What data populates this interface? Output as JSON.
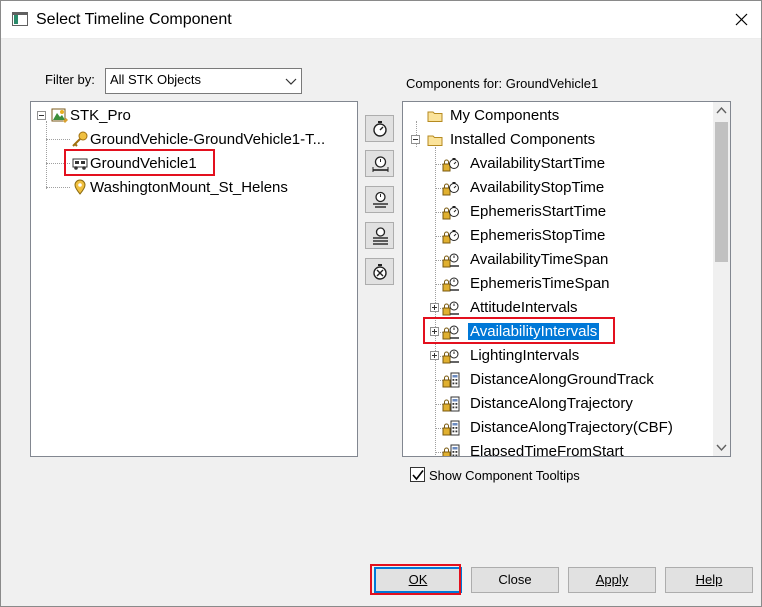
{
  "window": {
    "title": "Select Timeline Component"
  },
  "filter": {
    "label": "Filter by:",
    "selected": "All STK Objects"
  },
  "objects_tree": {
    "items": [
      {
        "label": "STK_Pro",
        "icon": "scenario-icon"
      },
      {
        "label": "GroundVehicle-GroundVehicle1-T...",
        "icon": "access-key-icon"
      },
      {
        "label": "GroundVehicle1",
        "icon": "ground-vehicle-icon",
        "highlighted": true
      },
      {
        "label": "WashingtonMount_St_Helens",
        "icon": "place-pin-icon"
      }
    ]
  },
  "components": {
    "label": "Components for: GroundVehicle1",
    "items": [
      {
        "label": "My Components",
        "icon": "folder-icon"
      },
      {
        "label": "Installed Components",
        "icon": "folder-icon"
      },
      {
        "label": "AvailabilityStartTime",
        "icon": "time-instant-icon"
      },
      {
        "label": "AvailabilityStopTime",
        "icon": "time-instant-icon"
      },
      {
        "label": "EphemerisStartTime",
        "icon": "time-instant-icon"
      },
      {
        "label": "EphemerisStopTime",
        "icon": "time-instant-icon"
      },
      {
        "label": "AvailabilityTimeSpan",
        "icon": "time-span-icon"
      },
      {
        "label": "EphemerisTimeSpan",
        "icon": "time-span-icon"
      },
      {
        "label": "AttitudeIntervals",
        "icon": "time-span-icon"
      },
      {
        "label": "AvailabilityIntervals",
        "icon": "time-span-icon",
        "selected": true
      },
      {
        "label": "LightingIntervals",
        "icon": "time-span-icon"
      },
      {
        "label": "DistanceAlongGroundTrack",
        "icon": "calc-icon"
      },
      {
        "label": "DistanceAlongTrajectory",
        "icon": "calc-icon"
      },
      {
        "label": "DistanceAlongTrajectory(CBF)",
        "icon": "calc-icon"
      },
      {
        "label": "ElapsedTimeFromStart",
        "icon": "calc-icon"
      }
    ]
  },
  "tooltips_checkbox": {
    "label": "Show Component Tooltips",
    "checked": true
  },
  "buttons": {
    "ok": "OK",
    "close": "Close",
    "apply": "Apply",
    "help": "Help"
  },
  "colors": {
    "selection": "#0078d7",
    "highlight_box": "#e3101e"
  }
}
